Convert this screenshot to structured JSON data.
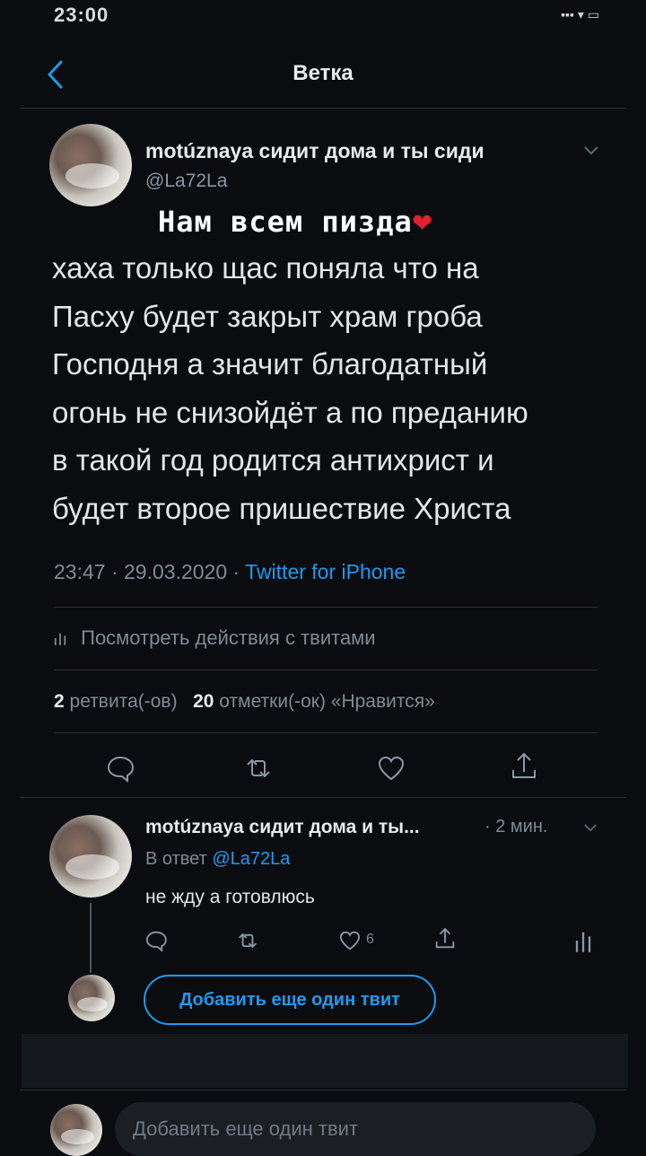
{
  "status_bar": {
    "time": "23:00",
    "icons": "▪▪▪ ▾ ▭"
  },
  "nav": {
    "title": "Ветка",
    "back_icon": "chevron-left-icon"
  },
  "tweet": {
    "author_name": "motúznaya сидит дома и ты сиди",
    "handle": "@La72La",
    "overlay_text": "Нам всем пизда",
    "overlay_emoji": "❤",
    "body_lines": [
      "хаха только щас поняла что на",
      "Пасху будет закрыт храм гроба",
      "Господня а значит благодатный",
      "огонь не снизойдёт а по преданию",
      "в такой год родится антихрист и",
      "будет второе пришествие Христа"
    ],
    "time": "23:47",
    "date": "29.03.2020",
    "source": "Twitter for iPhone",
    "stats_link": "Посмотреть действия с твитами",
    "retweets_count": "2",
    "retweets_label": "ретвита(-ов)",
    "likes_count": "20",
    "likes_label": "отметки(-ок) «Нравится»"
  },
  "reply": {
    "author_name": "motúznaya сидит дома и ты...",
    "time": "· 2 мин.",
    "reply_to_prefix": "В ответ",
    "reply_to_handle": "@La72La",
    "text": "не жду а готовлюсь",
    "like_count": "6"
  },
  "add_tweet_button": "Добавить еще один твит",
  "compose_placeholder": "Добавить еще один твит",
  "colors": {
    "background": "#0a0c10",
    "accent": "#1d9bf0",
    "text": "#e7ebee",
    "muted": "#7f8c95",
    "heart": "#e0212f"
  }
}
